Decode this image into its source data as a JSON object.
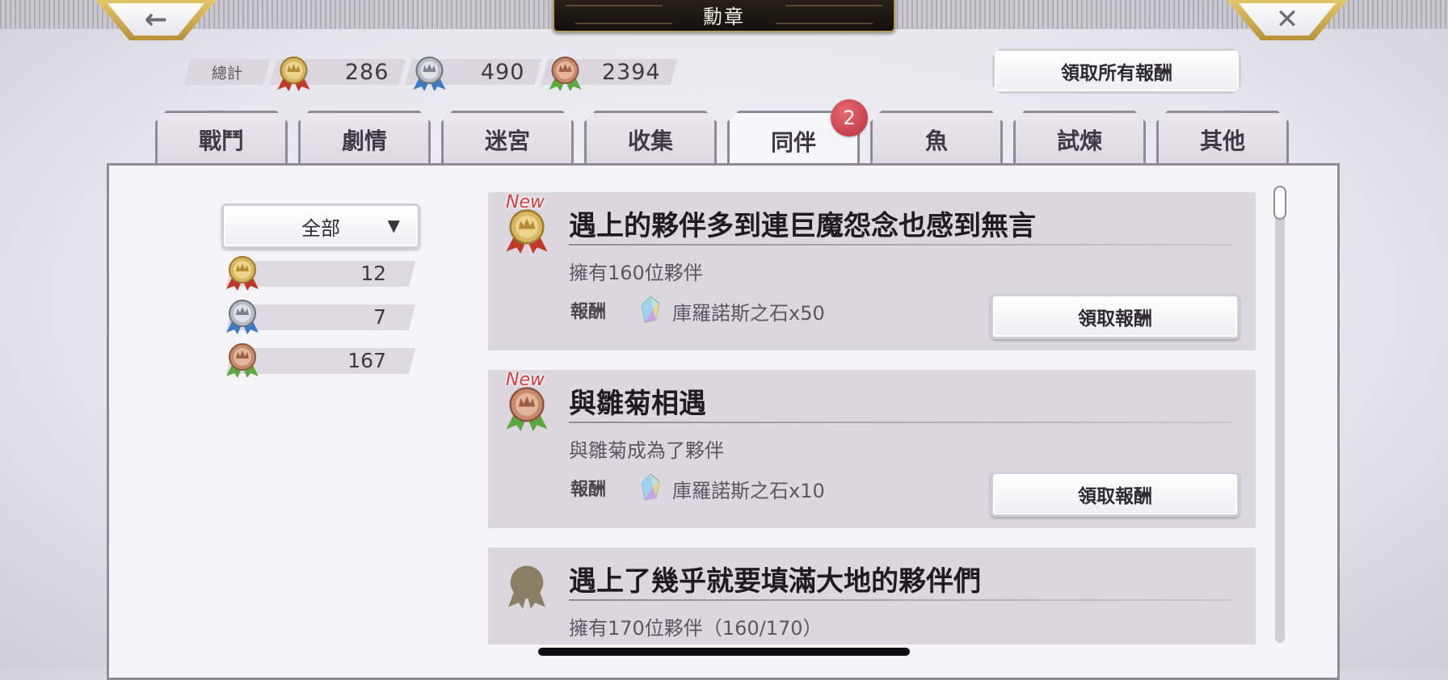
{
  "header": {
    "title": "勳章",
    "back_icon": "←",
    "close_icon": "✕"
  },
  "totals": {
    "label": "總計",
    "gold": "286",
    "silver": "490",
    "bronze": "2394"
  },
  "claim_all_label": "領取所有報酬",
  "tabs": [
    {
      "label": "戰鬥"
    },
    {
      "label": "劇情"
    },
    {
      "label": "迷宮"
    },
    {
      "label": "收集"
    },
    {
      "label": "同伴",
      "active": true
    },
    {
      "label": "魚"
    },
    {
      "label": "試煉"
    },
    {
      "label": "其他"
    }
  ],
  "tab_badge": "2",
  "filter": {
    "selected": "全部",
    "caret": "▼"
  },
  "medal_stats": [
    {
      "tier": "gold",
      "count": "12"
    },
    {
      "tier": "silver",
      "count": "7"
    },
    {
      "tier": "bronze",
      "count": "167"
    }
  ],
  "achievements": [
    {
      "new_label": "New",
      "medal": "gold",
      "title": "遇上的夥伴多到連巨魔怨念也感到無言",
      "description": "擁有160位夥伴",
      "reward_label": "報酬",
      "reward": "庫羅諾斯之石x50",
      "claim_label": "領取報酬"
    },
    {
      "new_label": "New",
      "medal": "bronze",
      "title": "與雛菊相遇",
      "description": "與雛菊成為了夥伴",
      "reward_label": "報酬",
      "reward": "庫羅諾斯之石x10",
      "claim_label": "領取報酬"
    },
    {
      "medal": "locked",
      "title": "遇上了幾乎就要填滿大地的夥伴們",
      "description": "擁有170位夥伴（160/170）"
    }
  ],
  "colors": {
    "gold_medal": "#d8b560",
    "silver_medal": "#b8bcc4",
    "bronze_medal": "#c98b6e",
    "red_ribbon": "#c0392b",
    "blue_ribbon": "#3d7cc4",
    "green_ribbon": "#5aa83e",
    "locked_medal": "#8b7f66",
    "new_tag": "#d63a3e",
    "badge": "#c23a45"
  }
}
